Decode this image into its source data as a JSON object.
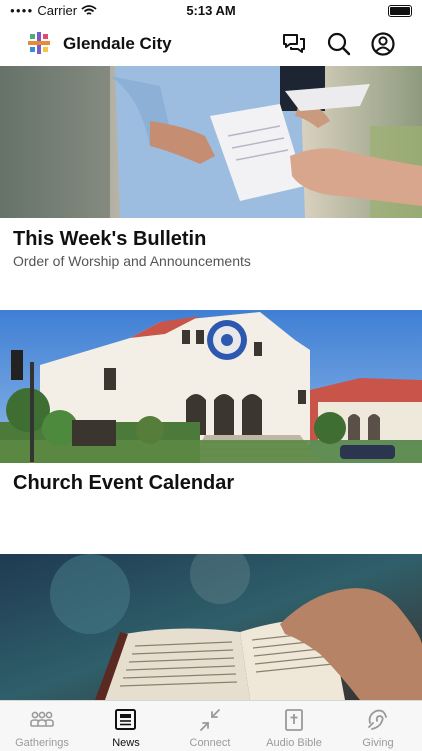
{
  "status_bar": {
    "carrier": "Carrier",
    "time": "5:13 AM"
  },
  "header": {
    "app_title": "Glendale City"
  },
  "cards": [
    {
      "title": "This Week's Bulletin",
      "subtitle": "Order of Worship and Announcements",
      "image": "bulletin-handout-photo"
    },
    {
      "title": "Church Event Calendar",
      "subtitle": "",
      "image": "church-building-photo"
    },
    {
      "title": "",
      "subtitle": "",
      "image": "open-bible-photo"
    }
  ],
  "tabs": [
    {
      "label": "Gatherings",
      "icon": "people-icon",
      "active": false
    },
    {
      "label": "News",
      "icon": "news-icon",
      "active": true
    },
    {
      "label": "Connect",
      "icon": "connect-icon",
      "active": false
    },
    {
      "label": "Audio Bible",
      "icon": "bible-icon",
      "active": false
    },
    {
      "label": "Giving",
      "icon": "giving-icon",
      "active": false
    }
  ]
}
